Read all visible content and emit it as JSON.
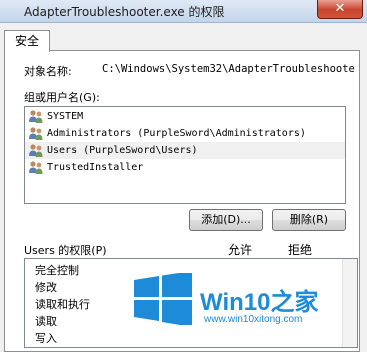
{
  "window": {
    "title": "AdapterTroubleshooter.exe 的权限",
    "close_label": "✕"
  },
  "tabs": [
    {
      "label": "安全"
    }
  ],
  "object": {
    "label": "对象名称:",
    "value": "C:\\Windows\\System32\\AdapterTroubleshoote"
  },
  "groups": {
    "label": "组或用户名(G):",
    "items": [
      {
        "label": "SYSTEM"
      },
      {
        "label": "Administrators (PurpleSword\\Administrators)"
      },
      {
        "label": "Users (PurpleSword\\Users)"
      },
      {
        "label": "TrustedInstaller"
      }
    ],
    "selected_index": 2
  },
  "buttons": {
    "add": "添加(D)...",
    "remove": "删除(R)"
  },
  "permissions": {
    "label": "Users 的权限(P)",
    "allow_header": "允许",
    "deny_header": "拒绝",
    "items": [
      {
        "label": "完全控制"
      },
      {
        "label": "修改"
      },
      {
        "label": "读取和执行"
      },
      {
        "label": "读取"
      },
      {
        "label": "写入"
      }
    ]
  },
  "watermark": {
    "brand": "Win10",
    "brand_suffix": "之家",
    "url": "www.win10xitong.com",
    "colors": {
      "blue": "#1e8bd8"
    }
  }
}
